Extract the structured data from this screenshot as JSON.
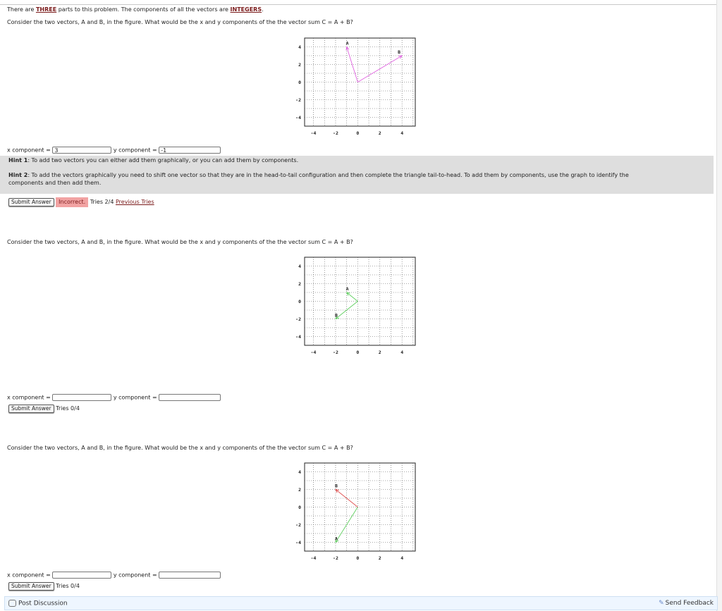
{
  "header": {
    "prefix": "There are ",
    "emphasis_count": "THREE",
    "middle": " parts to this problem. The components of all the vectors are ",
    "emphasis_type": "INTEGERS",
    "suffix": "."
  },
  "parts": [
    {
      "question": "Consider the two vectors, A and B, in the figure. What would be the x and y components of the the vector sum C = A + B?",
      "x_label": "x component =",
      "x_value": "3",
      "y_label": "y component =",
      "y_value": "-1",
      "submit_label": "Submit Answer",
      "status": "Incorrect.",
      "tries": "Tries 2/4",
      "previous_tries": "Previous Tries",
      "hints": [
        {
          "title": "Hint 1",
          "text": ": To add two vectors you can either add them graphically, or you can add them by components."
        },
        {
          "title": "Hint 2",
          "text": ": To add the vectors graphically you need to shift one vector so that they are in the head-to-tail configuration and then complete the triangle tail-to-head. To add them by components, use the graph to identify the",
          "text2": "components and then add them."
        }
      ],
      "graph": {
        "x_ticks": [
          "-4",
          "-2",
          "0",
          "2",
          "4"
        ],
        "y_ticks": [
          "4",
          "2",
          "0",
          "-2",
          "-4"
        ],
        "vectors": [
          {
            "name": "A",
            "from": [
              0,
              0
            ],
            "to": [
              -1,
              4
            ],
            "color": "#e060e0"
          },
          {
            "name": "B",
            "from": [
              0,
              0
            ],
            "to": [
              4,
              3
            ],
            "color": "#e060e0"
          }
        ]
      }
    },
    {
      "question": "Consider the two vectors, A and B, in the figure. What would be the x and y components of the the vector sum C = A + B?",
      "x_label": "x component =",
      "x_value": "",
      "y_label": "y component =",
      "y_value": "",
      "submit_label": "Submit Answer",
      "tries": "Tries 0/4",
      "graph": {
        "x_ticks": [
          "-4",
          "-2",
          "0",
          "2",
          "4"
        ],
        "y_ticks": [
          "4",
          "2",
          "0",
          "-2",
          "-4"
        ],
        "vectors": [
          {
            "name": "A",
            "from": [
              0,
              0
            ],
            "to": [
              -1,
              1
            ],
            "color": "#60d060"
          },
          {
            "name": "B",
            "from": [
              0,
              0
            ],
            "to": [
              -2,
              -2
            ],
            "color": "#60d060"
          }
        ]
      }
    },
    {
      "question": "Consider the two vectors, A and B, in the figure. What would be the x and y components of the the vector sum C = A + B?",
      "x_label": "x component =",
      "x_value": "",
      "y_label": "y component =",
      "y_value": "",
      "submit_label": "Submit Answer",
      "tries": "Tries 0/4",
      "graph": {
        "x_ticks": [
          "-4",
          "-2",
          "0",
          "2",
          "4"
        ],
        "y_ticks": [
          "4",
          "2",
          "0",
          "-2",
          "-4"
        ],
        "vectors": [
          {
            "name": "A",
            "from": [
              0,
              0
            ],
            "to": [
              -2,
              -4
            ],
            "color": "#60d060"
          },
          {
            "name": "B",
            "from": [
              0,
              0
            ],
            "to": [
              -2,
              2
            ],
            "color": "#e05050"
          }
        ]
      }
    }
  ],
  "footer": {
    "post_discussion": "Post Discussion",
    "send_feedback": "Send Feedback"
  }
}
